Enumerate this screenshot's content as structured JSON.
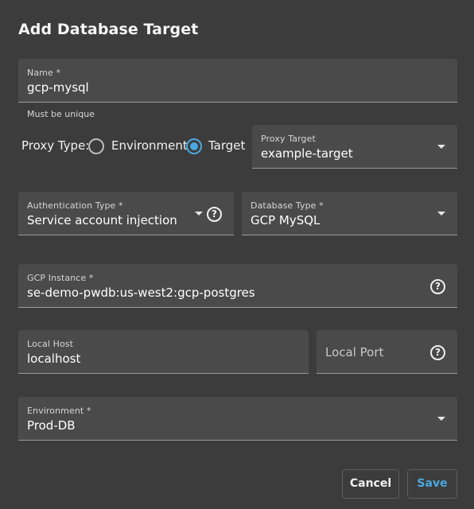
{
  "dialog": {
    "title": "Add Database Target"
  },
  "fields": {
    "name": {
      "label": "Name *",
      "value": "gcp-mysql",
      "hint": "Must be unique"
    },
    "proxy_type": {
      "label": "Proxy Type:",
      "options": [
        "Environment",
        "Target"
      ],
      "selected": "Target"
    },
    "proxy_target": {
      "label": "Proxy Target",
      "value": "example-target"
    },
    "auth_type": {
      "label": "Authentication Type *",
      "value": "Service account injection"
    },
    "db_type": {
      "label": "Database Type *",
      "value": "GCP MySQL"
    },
    "gcp_instance": {
      "label": "GCP Instance *",
      "value": "se-demo-pwdb:us-west2:gcp-postgres"
    },
    "local_host": {
      "label": "Local Host",
      "value": "localhost"
    },
    "local_port": {
      "placeholder": "Local Port",
      "value": ""
    },
    "environment": {
      "label": "Environment *",
      "value": "Prod-DB"
    }
  },
  "actions": {
    "cancel_label": "Cancel",
    "save_label": "Save"
  },
  "icons": {
    "help": "help-circle-icon",
    "dropdown": "chevron-down-icon"
  },
  "colors": {
    "background": "#3c3c3c",
    "field": "#4a4a4a",
    "accent": "#4aa8e0"
  }
}
